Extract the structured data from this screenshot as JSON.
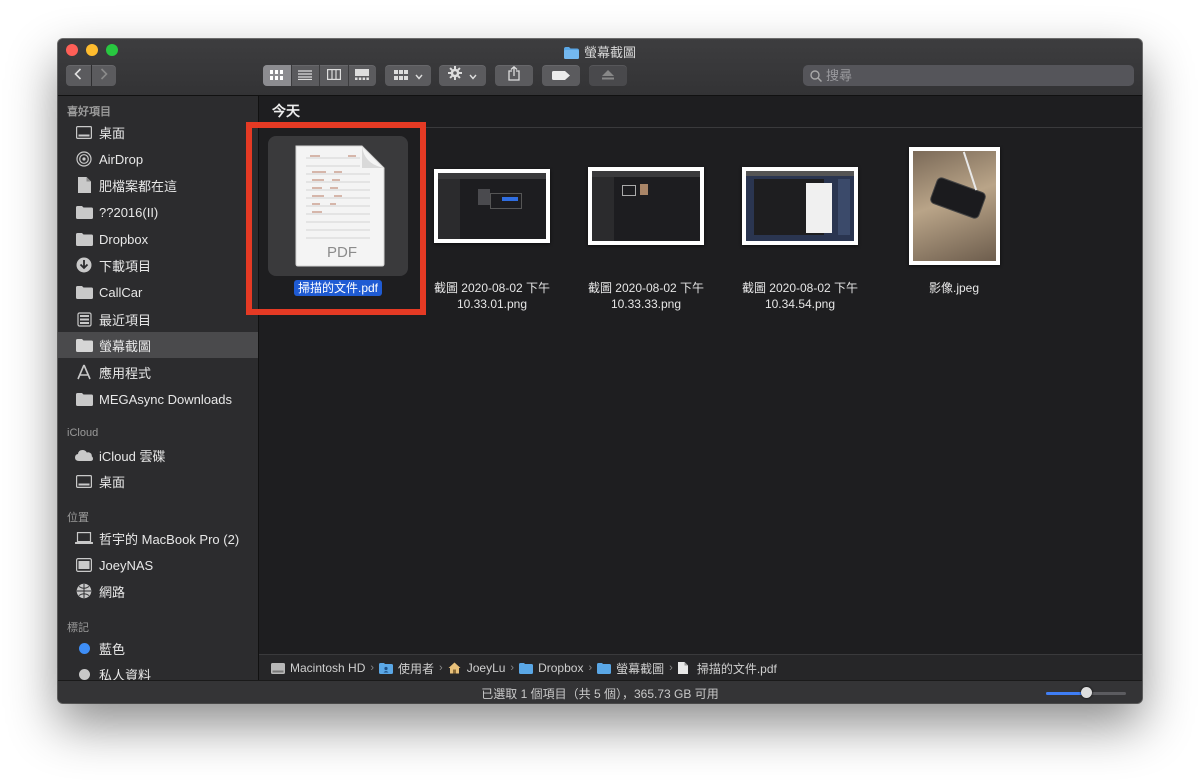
{
  "window": {
    "title": "螢幕截圖"
  },
  "toolbar": {
    "search_placeholder": "搜尋"
  },
  "sidebar": {
    "favorites_header": "喜好項目",
    "favorites": [
      {
        "label": "桌面",
        "icon": "desktop-icon"
      },
      {
        "label": "AirDrop",
        "icon": "airdrop-icon"
      },
      {
        "label": "肥檔案都在這",
        "icon": "document-icon"
      },
      {
        "label": "??2016(II)",
        "icon": "folder-icon"
      },
      {
        "label": "Dropbox",
        "icon": "folder-icon"
      },
      {
        "label": "下載項目",
        "icon": "download-icon"
      },
      {
        "label": "CallCar",
        "icon": "folder-icon"
      },
      {
        "label": "最近項目",
        "icon": "recents-icon"
      },
      {
        "label": "螢幕截圖",
        "icon": "folder-icon",
        "selected": true
      },
      {
        "label": "應用程式",
        "icon": "applications-icon"
      },
      {
        "label": "MEGAsync Downloads",
        "icon": "folder-icon"
      }
    ],
    "icloud_header": "iCloud",
    "icloud": [
      {
        "label": "iCloud 雲碟",
        "icon": "cloud-icon"
      },
      {
        "label": "桌面",
        "icon": "desktop-icon"
      }
    ],
    "locations_header": "位置",
    "locations": [
      {
        "label": "哲宇的 MacBook Pro (2)",
        "icon": "laptop-icon"
      },
      {
        "label": "JoeyNAS",
        "icon": "server-icon"
      },
      {
        "label": "網路",
        "icon": "network-icon"
      }
    ],
    "tags_header": "標記",
    "tags": [
      {
        "label": "藍色",
        "color": "#3e8ef7"
      },
      {
        "label": "私人資料",
        "color": "#c8c8c8"
      }
    ]
  },
  "main": {
    "section_title": "今天",
    "files": [
      {
        "name": "掃描的文件.pdf",
        "kind": "pdf",
        "selected": true,
        "thumb_label": "PDF"
      },
      {
        "name_line1": "截圖 2020-08-02 下午",
        "name_line2": "10.33.01.png",
        "kind": "screenshot"
      },
      {
        "name_line1": "截圖 2020-08-02 下午",
        "name_line2": "10.33.33.png",
        "kind": "screenshot"
      },
      {
        "name_line1": "截圖 2020-08-02 下午",
        "name_line2": "10.34.54.png",
        "kind": "screenshot"
      },
      {
        "name": "影像.jpeg",
        "kind": "photo"
      }
    ]
  },
  "pathbar": {
    "crumbs": [
      {
        "label": "Macintosh HD",
        "icon": "drive-icon"
      },
      {
        "label": "使用者",
        "icon": "users-folder-icon"
      },
      {
        "label": "JoeyLu",
        "icon": "home-icon"
      },
      {
        "label": "Dropbox",
        "icon": "folder-icon"
      },
      {
        "label": "螢幕截圖",
        "icon": "folder-icon"
      },
      {
        "label": "掃描的文件.pdf",
        "icon": "document-icon"
      }
    ],
    "separator": "›"
  },
  "status": {
    "text": "已選取 1 個項目（共 5 個），365.73 GB 可用",
    "zoom_level": 0.5
  },
  "colors": {
    "accent": "#1f5bd3",
    "highlight_box": "#e53a24"
  }
}
